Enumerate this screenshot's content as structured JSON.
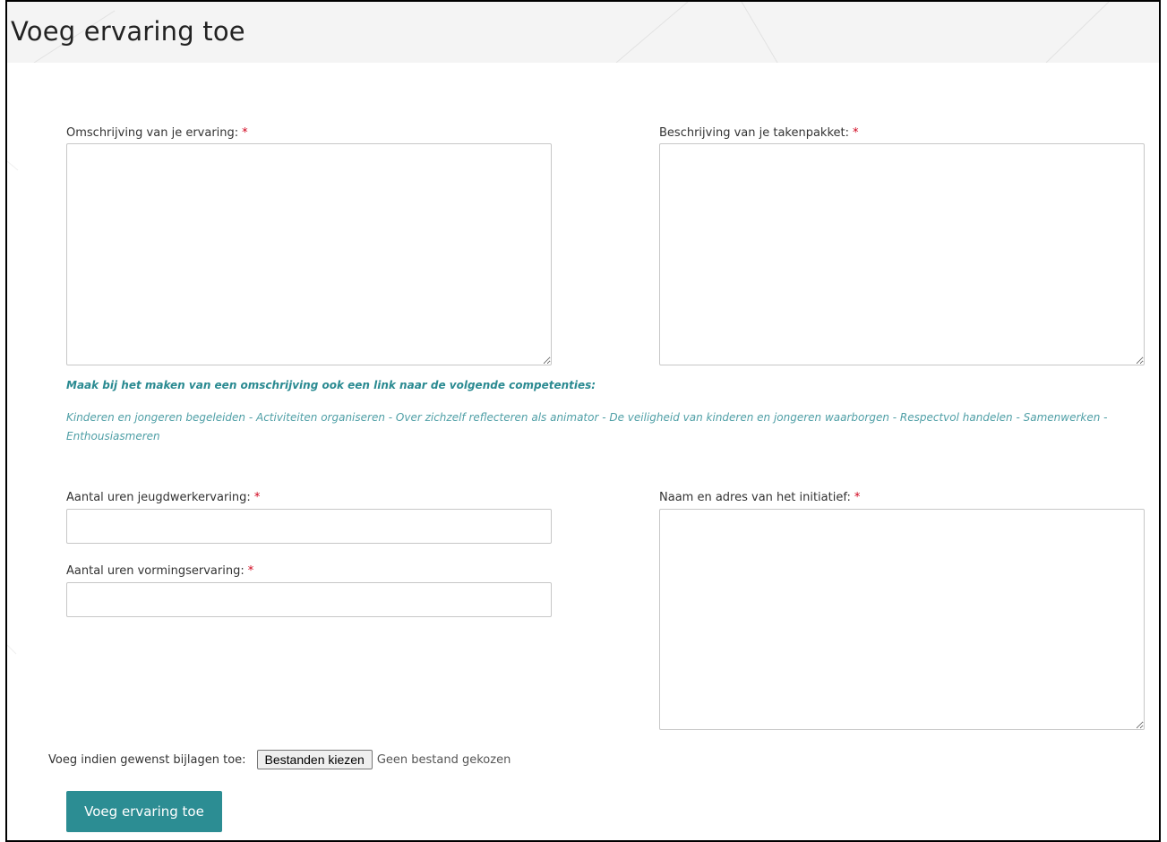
{
  "page": {
    "title": "Voeg ervaring toe"
  },
  "form": {
    "required_marker": "*",
    "omschrijving": {
      "label": "Omschrijving van je ervaring:",
      "value": ""
    },
    "takenpakket": {
      "label": "Beschrijving van je takenpakket:",
      "value": ""
    },
    "hint": {
      "title": "Maak bij het maken van een omschrijving ook een link naar de volgende competenties:",
      "body": "Kinderen en jongeren begeleiden - Activiteiten organiseren - Over zichzelf reflecteren als animator - De veiligheid van kinderen en jongeren waarborgen - Respectvol handelen - Samenwerken - Enthousiasmeren"
    },
    "uren_jeugdwerk": {
      "label": "Aantal uren jeugdwerkervaring:",
      "value": ""
    },
    "uren_vorming": {
      "label": "Aantal uren vormingservaring:",
      "value": ""
    },
    "initiatief": {
      "label": "Naam en adres van het initiatief:",
      "value": ""
    },
    "bijlagen": {
      "label": "Voeg indien gewenst bijlagen toe:",
      "button": "Bestanden kiezen",
      "status": "Geen bestand gekozen"
    },
    "submit_label": "Voeg ervaring toe"
  },
  "colors": {
    "accent": "#2c8d93",
    "hint_title": "#2a8a91",
    "hint_body": "#4f9fa6",
    "required": "#d0021b",
    "header_bg": "#f4f4f4"
  }
}
